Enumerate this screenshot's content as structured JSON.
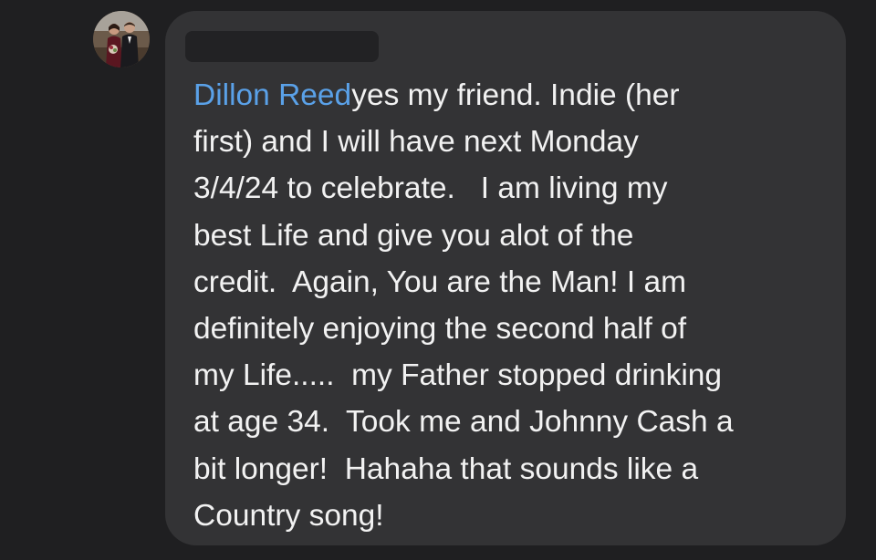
{
  "comment": {
    "mention": "Dillon Reed",
    "lines": [
      "yes my friend. Indie (her",
      "first) and I will have next Monday",
      "3/4/24 to celebrate.   I am living my",
      "best Life and give you alot of the",
      "credit.  Again, You are the Man! I am",
      "definitely enjoying the second half of",
      "my Life.....  my Father stopped drinking",
      "at age 34.  Took me and Johnny Cash a",
      "bit longer!  Hahaha that sounds like a",
      "Country song!"
    ]
  },
  "colors": {
    "background": "#1f1f21",
    "bubble": "#333335",
    "text": "#f2f2f2",
    "mention": "#5aa1e8",
    "redaction": "#222224"
  }
}
